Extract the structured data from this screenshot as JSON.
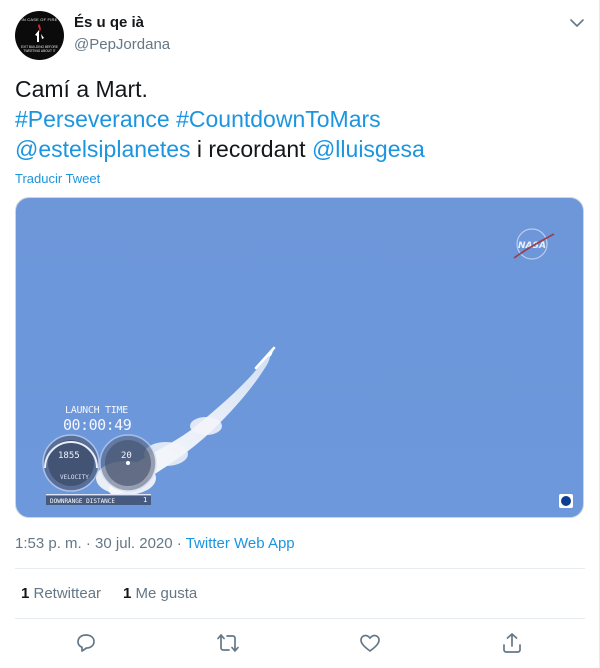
{
  "author": {
    "name": "És u qe ià",
    "handle": "@PepJordana",
    "avatar_top_text": "IN CASE OF FIRE",
    "avatar_bottom_text": "EXIT BUILDING BEFORE TWEETING ABOUT IT"
  },
  "tweet": {
    "line1": "Camí a Mart.",
    "hashtags": [
      "#Perseverance",
      "#CountdownToMars"
    ],
    "mention1": "@estelsiplanetes",
    "middle_text": " i recordant ",
    "mention2": "@lluisgesa",
    "translate_label": "Traducir Tweet"
  },
  "media": {
    "hud_label": "LAUNCH TIME",
    "hud_time": "00:00:49",
    "velocity_value": "1855",
    "velocity_label": "VELOCITY",
    "altitude_value": "20",
    "distance_label": "DOWNRANGE DISTANCE",
    "distance_value": "1",
    "logo_name": "nasa-logo"
  },
  "meta": {
    "time": "1:53 p. m.",
    "sep1": " · ",
    "date": "30 jul. 2020",
    "sep2": " · ",
    "app": "Twitter Web App"
  },
  "stats": {
    "retweets_count": "1",
    "retweets_label": " Retwittear",
    "likes_count": "1",
    "likes_label": " Me gusta"
  },
  "actions": [
    "reply-icon",
    "retweet-icon",
    "like-icon",
    "share-icon"
  ],
  "colors": {
    "link": "#1b95e0",
    "secondary": "#657786",
    "sky": "#6d97d9"
  }
}
